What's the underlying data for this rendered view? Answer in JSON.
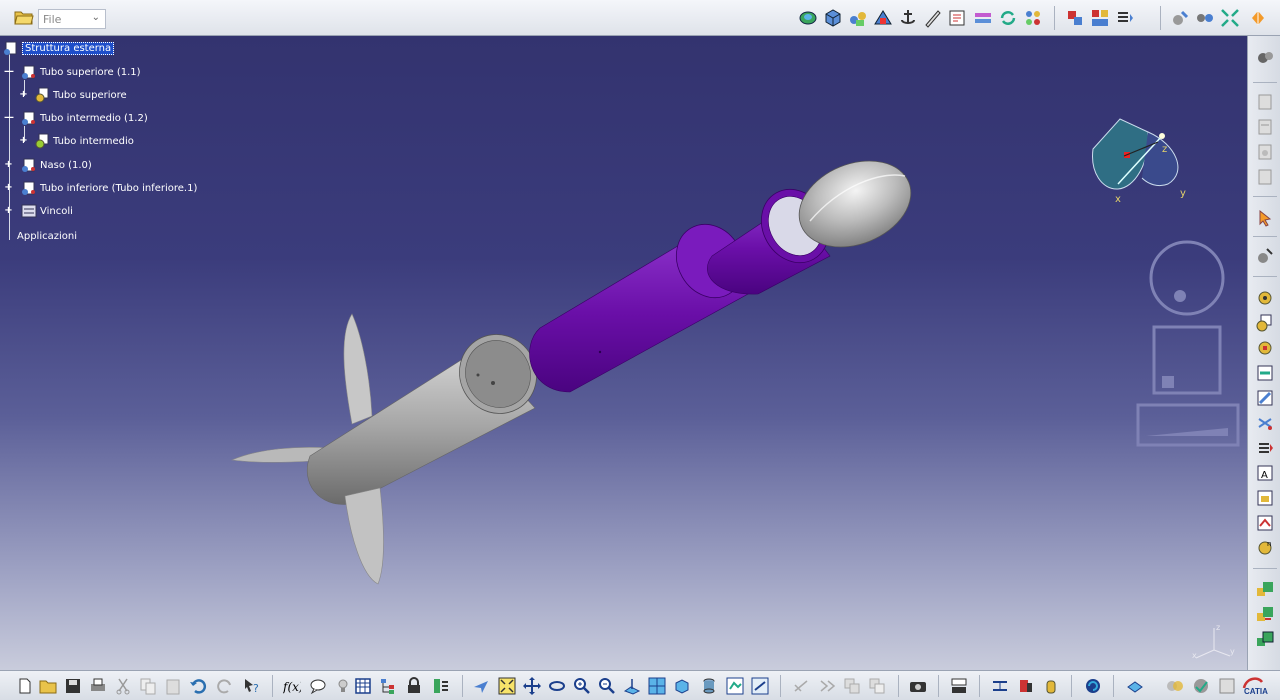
{
  "toolbar_top": {
    "file_label": "File",
    "icons": [
      "catalog-icon",
      "part-icon",
      "product-icon",
      "assembly-constraint-icon",
      "anchor-icon",
      "measure-icon",
      "annotation-icon",
      "exploded-view-icon",
      "update-icon",
      "multi-view-icon",
      "insert-component-icon",
      "replace-component-icon",
      "reorder-icon",
      "snap-icon",
      "manipulate-icon",
      "fit-all-icon",
      "catia-hand-icon"
    ]
  },
  "spec_tree": {
    "root": "Struttura esterna",
    "items": [
      {
        "label": "Tubo superiore (1.1)",
        "level": 1,
        "icon": "product-icon"
      },
      {
        "label": "Tubo superiore",
        "level": 2,
        "icon": "part-gear-icon"
      },
      {
        "label": "Tubo intermedio (1.2)",
        "level": 1,
        "icon": "product-icon"
      },
      {
        "label": "Tubo intermedio",
        "level": 2,
        "icon": "part-gear-icon"
      },
      {
        "label": "Naso (1.0)",
        "level": 1,
        "icon": "product-icon"
      },
      {
        "label": "Tubo inferiore (Tubo inferiore.1)",
        "level": 1,
        "icon": "product-icon"
      },
      {
        "label": "Vincoli",
        "level": 1,
        "icon": "constraints-icon"
      },
      {
        "label": "Applicazioni",
        "level": 0,
        "icon": "none"
      }
    ]
  },
  "compass": {
    "axis_x": "x",
    "axis_y": "y",
    "axis_z": "z"
  },
  "axis_triad": {
    "x": "x",
    "y": "y",
    "z": "z"
  },
  "catia_logo": "CATIA",
  "colors": {
    "purple_tube": "#6a0fa8",
    "grey_part": "#9a9a9a",
    "selection": "#1f4ec9"
  },
  "toolbar_bottom": {
    "icons": [
      "new-icon",
      "open-icon",
      "save-icon",
      "print-icon",
      "cut-icon",
      "copy-icon",
      "paste-icon",
      "undo-icon",
      "redo-icon",
      "whats-this-icon",
      "formula-icon",
      "comment-icon",
      "light-icon",
      "table-icon",
      "tree-icon",
      "lock-icon",
      "bom-icon",
      "fly-mode-icon",
      "fit-all-icon",
      "pan-icon",
      "rotate-icon",
      "zoom-in-icon",
      "zoom-out-icon",
      "normal-view-icon",
      "multi-view-icon",
      "iso-view-icon",
      "shading-icon",
      "hide-show-icon",
      "swap-space-icon",
      "sketch-icon",
      "render-icon",
      "camera-icon",
      "navigator-icon",
      "clash-icon",
      "section-icon",
      "measure-icon",
      "catia-icon",
      "box-icon",
      "view-mode-icon",
      "tools-icon"
    ]
  },
  "toolbar_right": {
    "icons": [
      "catalog-icon",
      "product-icon",
      "part-icon",
      "component-icon",
      "select-icon",
      "explode-icon",
      "snap-icon",
      "smart-move-icon",
      "gear-icon",
      "constraint-icon",
      "fix-icon",
      "contact-icon",
      "offset-icon",
      "angle-icon",
      "coincidence-icon",
      "reuse-icon",
      "flexible-icon",
      "multi-instantiate-icon",
      "publication-icon",
      "sync-icon",
      "green-part-icon"
    ]
  }
}
